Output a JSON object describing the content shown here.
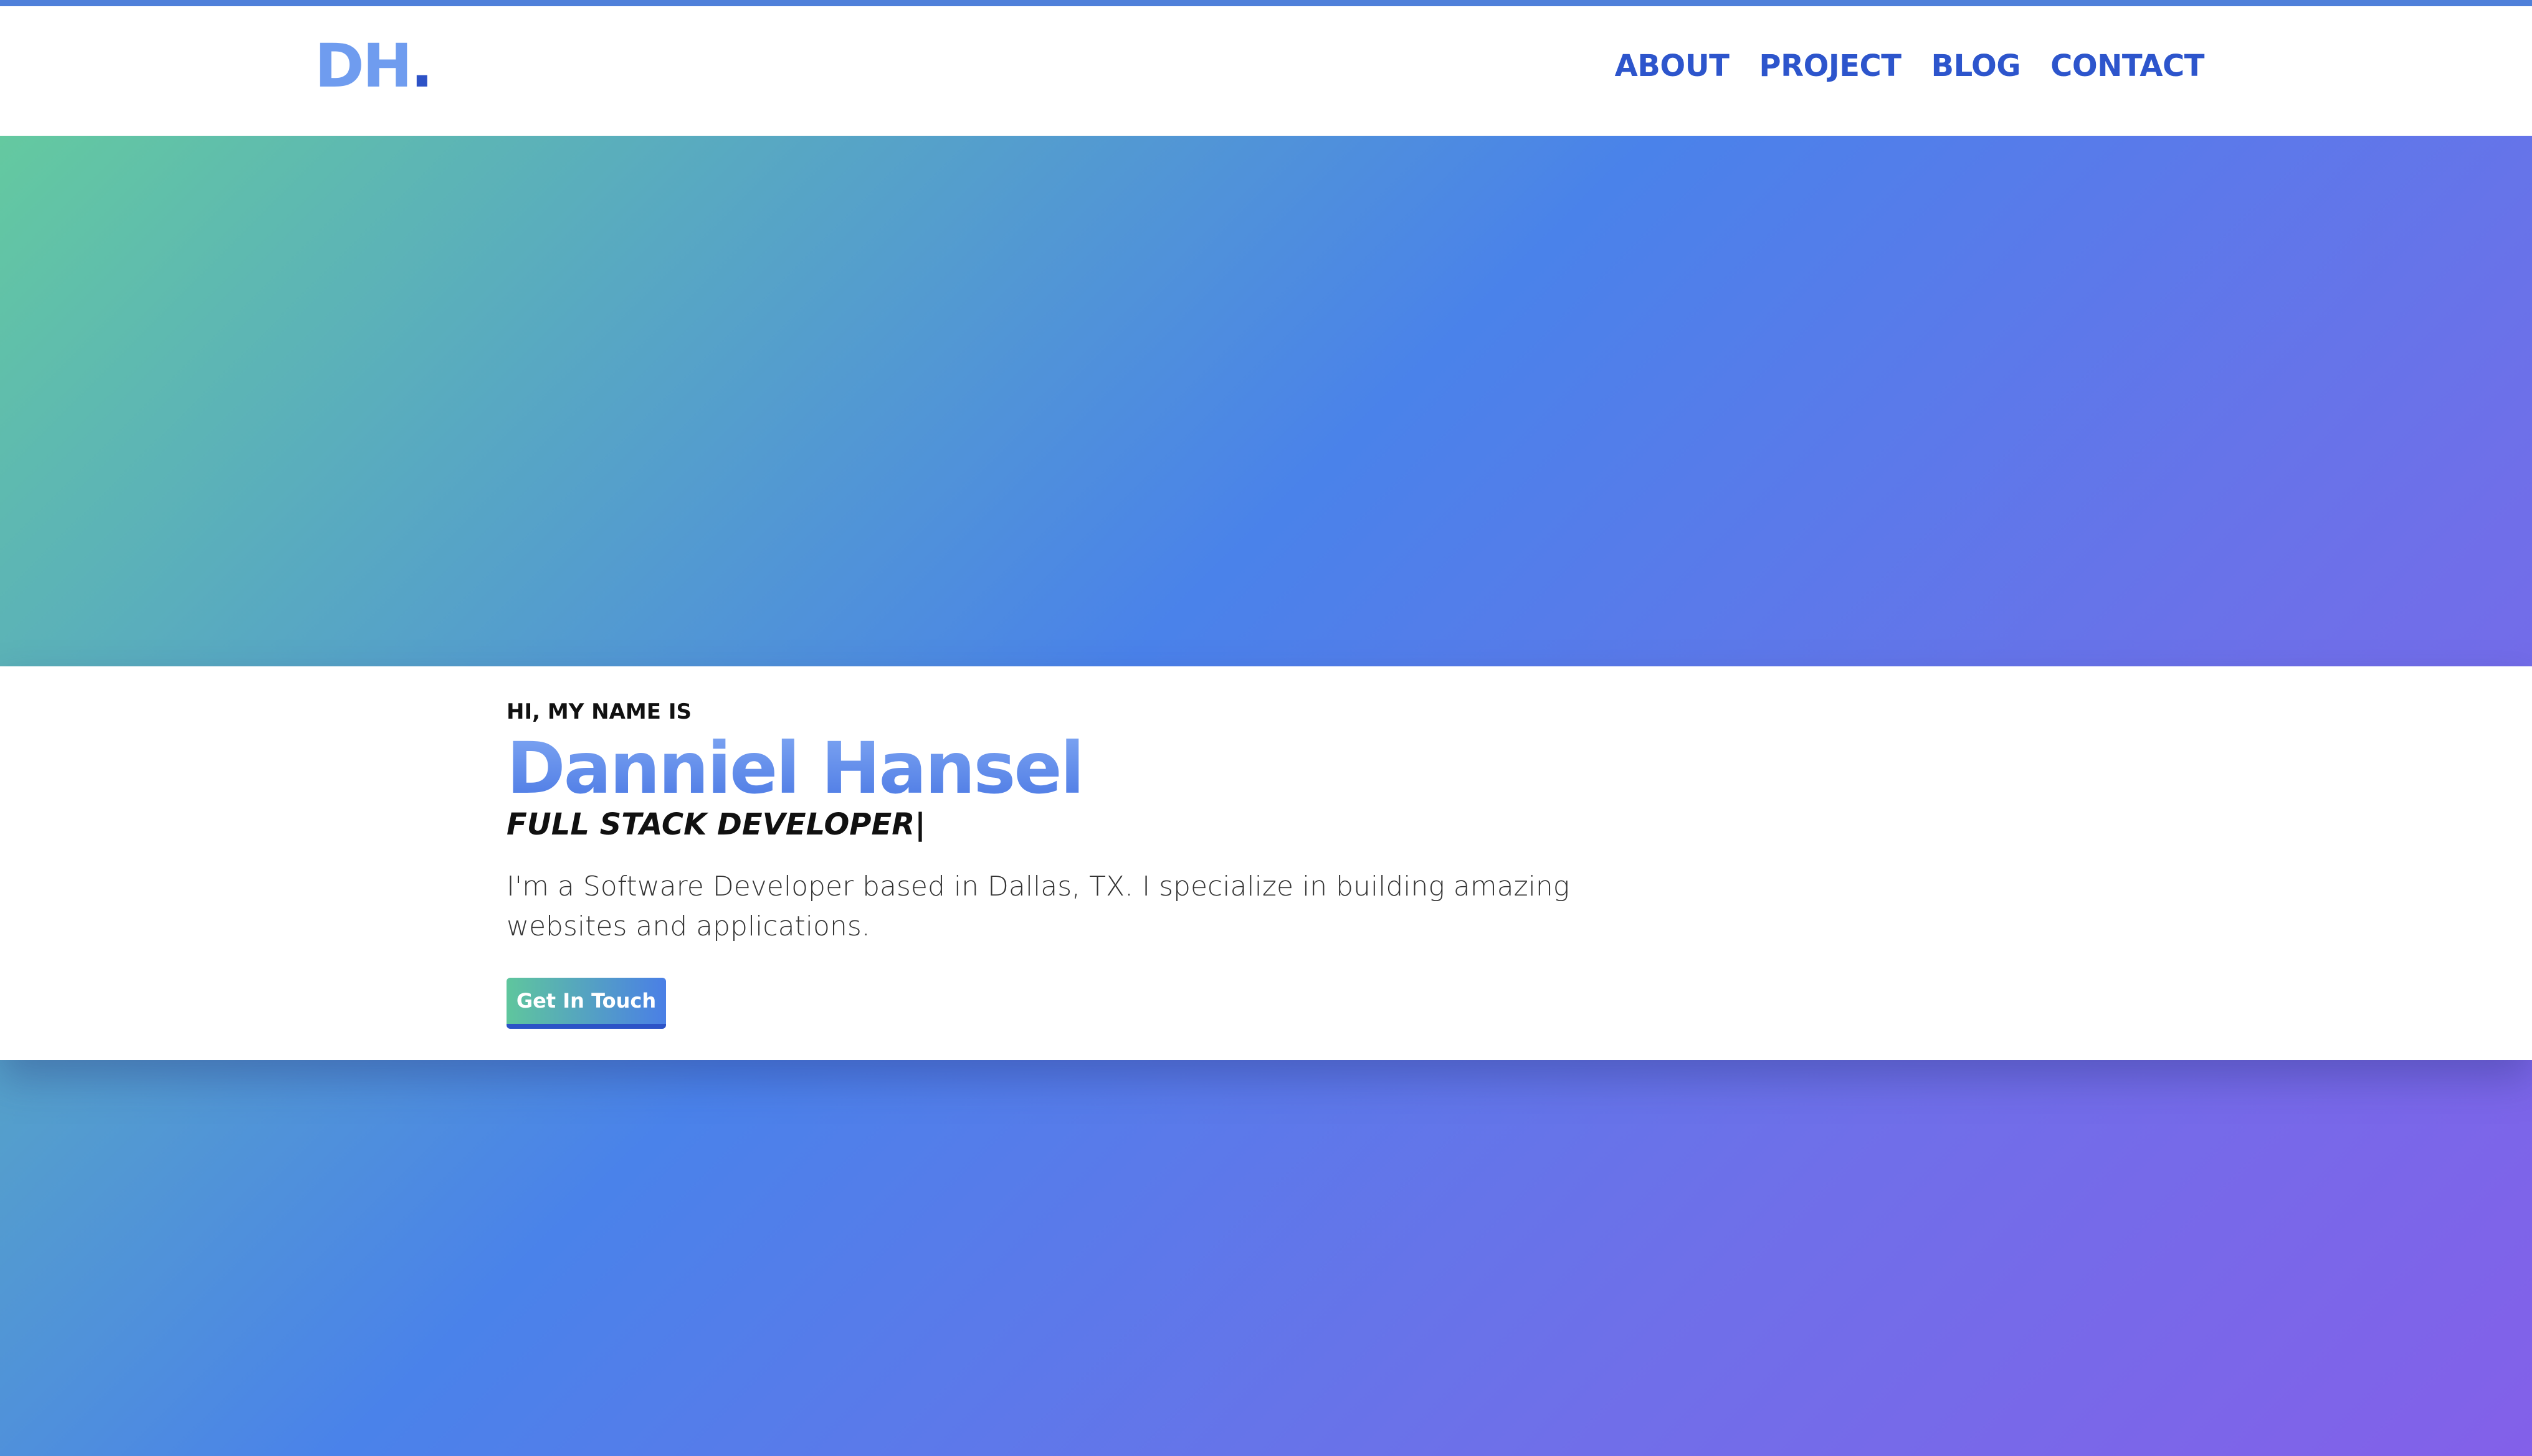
{
  "header": {
    "logo_text": "DH",
    "logo_dot": ".",
    "nav": [
      {
        "label": "ABOUT"
      },
      {
        "label": "PROJECT"
      },
      {
        "label": "BLOG"
      },
      {
        "label": "CONTACT"
      }
    ]
  },
  "hero": {
    "greeting": "HI, MY NAME IS",
    "name": "Danniel Hansel",
    "role": "FULL STACK DEVELOPER|",
    "description": "I'm a Software Developer based in Dallas, TX. I specialize in building amazing websites and applications.",
    "cta_label": "Get In Touch"
  },
  "colors": {
    "accent": "#2d55cc",
    "logo": "#6f9cef",
    "gradient_start": "#66cf9a",
    "gradient_mid": "#4a82ea",
    "gradient_end": "#8360e9"
  }
}
